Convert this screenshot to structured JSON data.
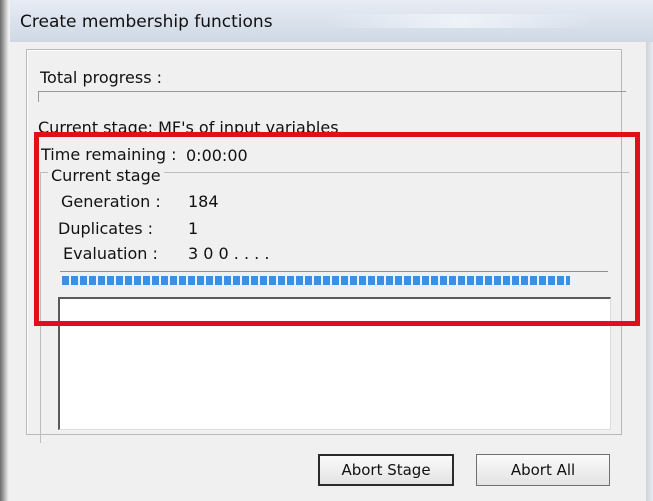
{
  "window": {
    "title": "Create membership functions"
  },
  "dialog": {
    "total_progress_label": "Total progress :",
    "total_progress_value": 0,
    "current_stage_label": "Current stage: MF's of input variables",
    "time_remaining_label": "Time remaining :",
    "time_remaining_value": "0:00:00",
    "stage_group": {
      "legend": "Current stage",
      "generation_label": "Generation :",
      "generation_value": "184",
      "duplicates_label": "Duplicates :",
      "duplicates_value": "1",
      "evaluation_label": "Evaluation :",
      "evaluation_value": "3 0 0 . . . .",
      "stage_progress": 0.93
    }
  },
  "buttons": {
    "abort_stage": "Abort Stage",
    "abort_all": "Abort All"
  },
  "annotation": {
    "highlight_color": "#e0101b"
  }
}
